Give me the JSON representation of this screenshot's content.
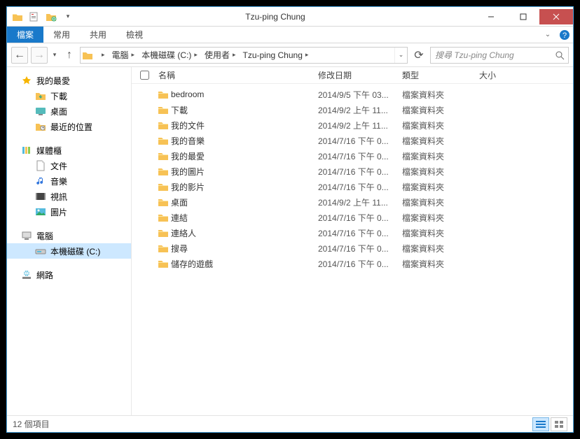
{
  "window": {
    "title": "Tzu-ping Chung"
  },
  "ribbon": {
    "file": "檔案",
    "home": "常用",
    "share": "共用",
    "view": "檢視"
  },
  "breadcrumbs": [
    "電腦",
    "本機磁碟 (C:)",
    "使用者",
    "Tzu-ping Chung"
  ],
  "search": {
    "placeholder": "搜尋 Tzu-ping Chung"
  },
  "columns": {
    "name": "名稱",
    "date": "修改日期",
    "type": "類型",
    "size": "大小"
  },
  "nav": {
    "favorites": {
      "label": "我的最愛",
      "items": [
        "下載",
        "桌面",
        "最近的位置"
      ]
    },
    "libraries": {
      "label": "媒體櫃",
      "items": [
        "文件",
        "音樂",
        "視訊",
        "圖片"
      ]
    },
    "computer": {
      "label": "電腦",
      "items": [
        "本機磁碟 (C:)"
      ]
    },
    "network": {
      "label": "網路"
    }
  },
  "files": [
    {
      "name": "bedroom",
      "date": "2014/9/5 下午 03...",
      "type": "檔案資料夾"
    },
    {
      "name": "下載",
      "date": "2014/9/2 上午 11...",
      "type": "檔案資料夾"
    },
    {
      "name": "我的文件",
      "date": "2014/9/2 上午 11...",
      "type": "檔案資料夾"
    },
    {
      "name": "我的音樂",
      "date": "2014/7/16 下午 0...",
      "type": "檔案資料夾"
    },
    {
      "name": "我的最愛",
      "date": "2014/7/16 下午 0...",
      "type": "檔案資料夾"
    },
    {
      "name": "我的圖片",
      "date": "2014/7/16 下午 0...",
      "type": "檔案資料夾"
    },
    {
      "name": "我的影片",
      "date": "2014/7/16 下午 0...",
      "type": "檔案資料夾"
    },
    {
      "name": "桌面",
      "date": "2014/9/2 上午 11...",
      "type": "檔案資料夾"
    },
    {
      "name": "連結",
      "date": "2014/7/16 下午 0...",
      "type": "檔案資料夾"
    },
    {
      "name": "連絡人",
      "date": "2014/7/16 下午 0...",
      "type": "檔案資料夾"
    },
    {
      "name": "搜尋",
      "date": "2014/7/16 下午 0...",
      "type": "檔案資料夾"
    },
    {
      "name": "儲存的遊戲",
      "date": "2014/7/16 下午 0...",
      "type": "檔案資料夾"
    }
  ],
  "status": {
    "count": "12 個項目"
  }
}
